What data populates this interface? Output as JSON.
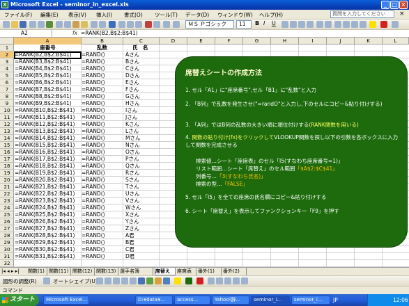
{
  "window": {
    "app_name": "Microsoft Excel - seminor_in_excel.xls",
    "app_icon_letter": "X",
    "minimize": "_",
    "maximize": "□",
    "close": "×"
  },
  "menubar": {
    "items": [
      "ファイル(F)",
      "編集(E)",
      "表示(V)",
      "挿入(I)",
      "書式(O)",
      "ツール(T)",
      "データ(D)",
      "ウィンドウ(W)",
      "ヘルプ(H)"
    ],
    "help_placeholder": "質問を入力してください",
    "close_glyph": "×"
  },
  "toolbar": {
    "font_name": "ＭＳ Ｐゴシック",
    "font_size": "11",
    "bold": "B",
    "italic": "I",
    "underline": "U"
  },
  "formula_bar": {
    "name_box": "A2",
    "fx": "fx",
    "value": "=RANK(B2,B$2:B$41)"
  },
  "columns": [
    "A",
    "B",
    "C",
    "D",
    "E",
    "F",
    "G",
    "H",
    "I",
    "J",
    "K",
    "L"
  ],
  "rows": [
    "1",
    "2",
    "3",
    "4",
    "5",
    "6",
    "7",
    "8",
    "9",
    "10",
    "11",
    "12",
    "13",
    "14",
    "15",
    "16",
    "17",
    "18",
    "19",
    "20",
    "21",
    "22",
    "23",
    "24",
    "25",
    "26",
    "27",
    "28",
    "29",
    "30",
    "31",
    "32"
  ],
  "header_row": {
    "a": "座番号",
    "b": "乱数",
    "c": "氏　名"
  },
  "cells": [
    {
      "a": "=RANK(B2,B$2:B$41)",
      "b": "=RAND()",
      "c": "Aさん"
    },
    {
      "a": "=RANK(B3,B$2:B$41)",
      "b": "=RAND()",
      "c": "Bさん"
    },
    {
      "a": "=RANK(B4,B$2:B$41)",
      "b": "=RAND()",
      "c": "Cさん"
    },
    {
      "a": "=RANK(B5,B$2:B$41)",
      "b": "=RAND()",
      "c": "Dさん"
    },
    {
      "a": "=RANK(B6,B$2:B$41)",
      "b": "=RAND()",
      "c": "Eさん"
    },
    {
      "a": "=RANK(B7,B$2:B$41)",
      "b": "=RAND()",
      "c": "Fさん"
    },
    {
      "a": "=RANK(B8,B$2:B$41)",
      "b": "=RAND()",
      "c": "Gさん"
    },
    {
      "a": "=RANK(B9,B$2:B$41)",
      "b": "=RAND()",
      "c": "Hさん"
    },
    {
      "a": "=RANK(B10,B$2:B$41)",
      "b": "=RAND()",
      "c": "Iさん"
    },
    {
      "a": "=RANK(B11,B$2:B$41)",
      "b": "=RAND()",
      "c": "Jさん"
    },
    {
      "a": "=RANK(B12,B$2:B$41)",
      "b": "=RAND()",
      "c": "Kさん"
    },
    {
      "a": "=RANK(B13,B$2:B$41)",
      "b": "=RAND()",
      "c": "Lさん"
    },
    {
      "a": "=RANK(B14,B$2:B$41)",
      "b": "=RAND()",
      "c": "Mさん"
    },
    {
      "a": "=RANK(B15,B$2:B$41)",
      "b": "=RAND()",
      "c": "Nさん"
    },
    {
      "a": "=RANK(B16,B$2:B$41)",
      "b": "=RAND()",
      "c": "Oさん"
    },
    {
      "a": "=RANK(B17,B$2:B$41)",
      "b": "=RAND()",
      "c": "Pさん"
    },
    {
      "a": "=RANK(B18,B$2:B$41)",
      "b": "=RAND()",
      "c": "Qさん"
    },
    {
      "a": "=RANK(B19,B$2:B$41)",
      "b": "=RAND()",
      "c": "Rさん"
    },
    {
      "a": "=RANK(B20,B$2:B$41)",
      "b": "=RAND()",
      "c": "Sさん"
    },
    {
      "a": "=RANK(B21,B$2:B$41)",
      "b": "=RAND()",
      "c": "Tさん"
    },
    {
      "a": "=RANK(B22,B$2:B$41)",
      "b": "=RAND()",
      "c": "Uさん"
    },
    {
      "a": "=RANK(B23,B$2:B$41)",
      "b": "=RAND()",
      "c": "Vさん"
    },
    {
      "a": "=RANK(B24,B$2:B$41)",
      "b": "=RAND()",
      "c": "Wさん"
    },
    {
      "a": "=RANK(B25,B$2:B$41)",
      "b": "=RAND()",
      "c": "Xさん"
    },
    {
      "a": "=RANK(B26,B$2:B$41)",
      "b": "=RAND()",
      "c": "Yさん"
    },
    {
      "a": "=RANK(B27,B$2:B$41)",
      "b": "=RAND()",
      "c": "Zさん"
    },
    {
      "a": "=RANK(B28,B$2:B$41)",
      "b": "=RAND()",
      "c": "A君"
    },
    {
      "a": "=RANK(B29,B$2:B$41)",
      "b": "=RAND()",
      "c": "B君"
    },
    {
      "a": "=RANK(B30,B$2:B$41)",
      "b": "=RAND()",
      "c": "C君"
    },
    {
      "a": "=RANK(B31,B$2:B$41)",
      "b": "=RAND()",
      "c": "D君"
    }
  ],
  "panel": {
    "title": "席替えシートの作成方法",
    "step1": "1. セル「A1」に\"座席番号\",セル「B1」に\"乱数\"と入力",
    "step2": "2. 「B列」で乱数を発生させ(\"=randO\"と入力し,下のセルにコピー&貼り付けする)",
    "step3_pre": "3. 「A列」ではB列の乱数の大きい順に順位付けする",
    "step3_hl": "(RANK関数を用いる)",
    "step4_pre": "4. ",
    "step4_hl": "関数の貼り付け(fx)をクリックして",
    "step4_post": "VLOOKUP関数を探し以下の引数を各ボックスに入力して関数を完成させる",
    "sub1": "検索値…シート「座席表」のセル「I5(すなわち座席番号=1)」",
    "sub2_pre": "リスト範囲…シート「席替え」のセル範囲",
    "sub2_hl": "「$A$2:$C$41」",
    "sub3_pre": "列番号…",
    "sub3_hl": "「3(すなわち氏名)」",
    "sub4_pre": "検索の型…",
    "sub4_hl": "「FALSE」",
    "step5": "5. セル「I5」を全ての座席の氏名欄にコピー&貼り付けする",
    "step6": "6. シート「席替え」を表示してファンクションキー「F9」を押す"
  },
  "sheet_tabs": [
    "関数(1)",
    "関数(11)",
    "関数(12)",
    "関数(13)",
    "選手名簿",
    "席替え",
    "座席表",
    "番外(1)",
    "番外(2)"
  ],
  "tab_nav": "|◂ ◂ ▸ ▸|",
  "drawbar": {
    "draw": "図形の調整(R)",
    "autoshape": "オートシェイプ(U)"
  },
  "status": "コマンド",
  "taskbar": {
    "start": "スタート",
    "tasks": [
      "Microsoft Excel...",
      "D:¥data¥...",
      "access...",
      "Yahoo!辞...",
      "seminor_i...",
      "seminor_i..."
    ],
    "ime": "JP",
    "clock": "12:06"
  }
}
